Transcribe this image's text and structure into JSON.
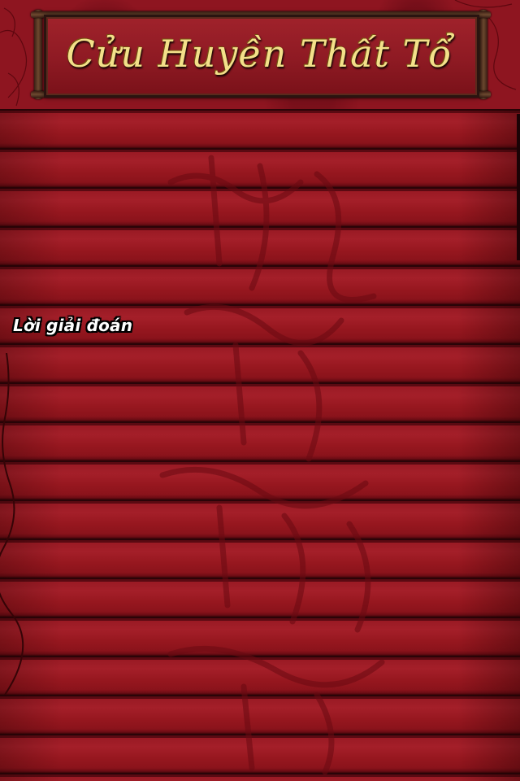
{
  "header": {
    "title": "Cửu Huyền Thất Tổ"
  },
  "content": {
    "section_label": "Lời giải đoán"
  },
  "colors": {
    "background": "#8e1520",
    "slat": "#a41f29",
    "title_gold": "#f3e08a",
    "label_text": "#ffffff"
  }
}
